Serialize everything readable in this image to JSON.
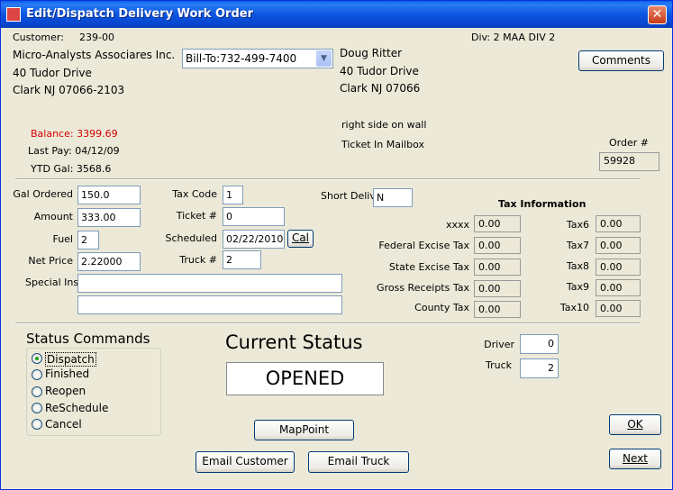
{
  "window": {
    "title": "Edit/Dispatch Delivery Work Order",
    "close_glyph": "✕"
  },
  "customer": {
    "label": "Customer:",
    "id": "239-00",
    "name": "Micro-Analysts Associares Inc.",
    "addr1": "40 Tudor Drive",
    "addr2": "Clark NJ 07066-2103",
    "balance": "Balance: 3399.69",
    "last_pay": "Last Pay: 04/12/09",
    "ytd_gal": "YTD Gal: 3568.6"
  },
  "division": "Div: 2  MAA DIV 2",
  "bill_to": {
    "selected": "Bill-To:732-499-7400"
  },
  "contact": {
    "name": "Doug Ritter",
    "addr1": "40 Tudor Drive",
    "addr2": "Clark NJ  07066",
    "note1": "right side on wall",
    "note2": "Ticket In Mailbox"
  },
  "buttons": {
    "comments": "Comments",
    "cal": "Cal",
    "mappoint": "MapPoint",
    "email_customer": "Email Customer",
    "email_truck": "Email Truck",
    "ok": "OK",
    "next": "Next"
  },
  "order": {
    "label": "Order #",
    "value": "59928"
  },
  "form": {
    "gal_ordered_label": "Gal Ordered",
    "gal_ordered": "150.0",
    "amount_label": "Amount",
    "amount": "333.00",
    "fuel_label": "Fuel",
    "fuel": "2",
    "net_price_label": "Net Price",
    "net_price": "2.22000",
    "special_ins_label": "Special Ins",
    "special_ins_1": "",
    "special_ins_2": "",
    "tax_code_label": "Tax Code",
    "tax_code": "1",
    "ticket_label": "Ticket #",
    "ticket": "0",
    "scheduled_label": "Scheduled",
    "scheduled": "02/22/2010",
    "truck_label": "Truck #",
    "truck": "2",
    "short_deliv_label": "Short Deliv",
    "short_deliv": "N"
  },
  "tax": {
    "heading": "Tax Information",
    "left": [
      {
        "label": "xxxx",
        "value": "0.00"
      },
      {
        "label": "Federal Excise Tax",
        "value": "0.00"
      },
      {
        "label": "State Excise Tax",
        "value": "0.00"
      },
      {
        "label": "Gross Receipts Tax",
        "value": "0.00"
      },
      {
        "label": "County Tax",
        "value": "0.00"
      }
    ],
    "right": [
      {
        "label": "Tax6",
        "value": "0.00"
      },
      {
        "label": "Tax7",
        "value": "0.00"
      },
      {
        "label": "Tax8",
        "value": "0.00"
      },
      {
        "label": "Tax9",
        "value": "0.00"
      },
      {
        "label": "Tax10",
        "value": "0.00"
      }
    ]
  },
  "status_commands": {
    "heading": "Status Commands",
    "options": [
      "Dispatch",
      "Finished",
      "Reopen",
      "ReSchedule",
      "Cancel"
    ],
    "selected": "Dispatch"
  },
  "current_status": {
    "heading": "Current Status",
    "value": "OPENED"
  },
  "assign": {
    "driver_label": "Driver",
    "driver": "0",
    "truck_label": "Truck",
    "truck": "2"
  }
}
